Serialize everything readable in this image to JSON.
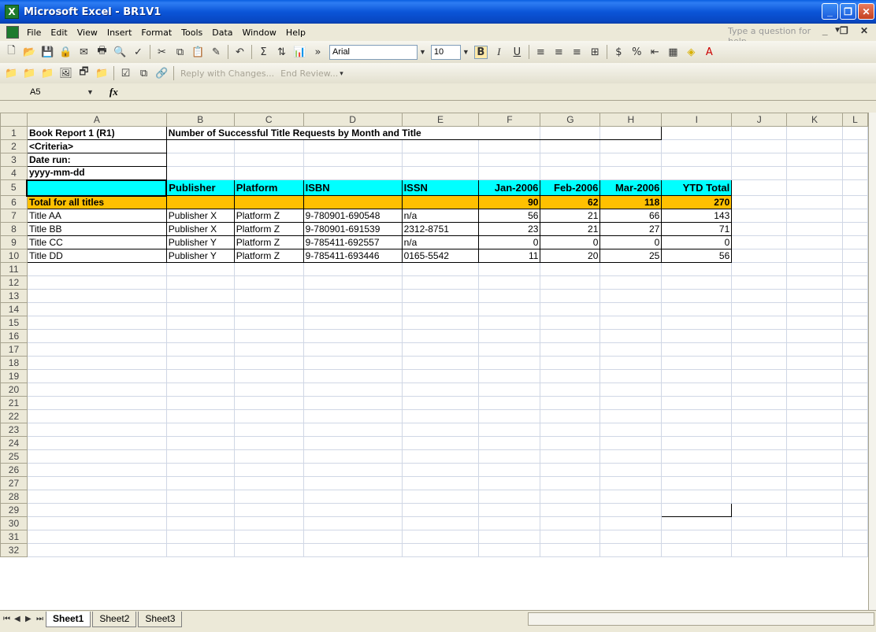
{
  "window": {
    "title": "Microsoft Excel - BR1V1",
    "app_icon": "excel-icon"
  },
  "menu": {
    "items": [
      "File",
      "Edit",
      "View",
      "Insert",
      "Format",
      "Tools",
      "Data",
      "Window",
      "Help"
    ],
    "ask_placeholder": "Type a question for help"
  },
  "toolbar": {
    "font": "Arial",
    "size": "10",
    "reply_label": "Reply with Changes...",
    "end_review_label": "End Review..."
  },
  "formula_bar": {
    "name_box": "A5",
    "fx": "fx"
  },
  "columns": [
    "A",
    "B",
    "C",
    "D",
    "E",
    "F",
    "G",
    "H",
    "I",
    "J",
    "K",
    "L"
  ],
  "sheet": {
    "r1": {
      "a": "Book Report 1 (R1)",
      "b": "Number of Successful Title Requests by Month and Title"
    },
    "r2": {
      "a": "<Criteria>"
    },
    "r3": {
      "a": "Date run:"
    },
    "r4": {
      "a": "yyyy-mm-dd"
    },
    "header": {
      "publisher": "Publisher",
      "platform": "Platform",
      "isbn": "ISBN",
      "issn": "ISSN",
      "jan": "Jan-2006",
      "feb": "Feb-2006",
      "mar": "Mar-2006",
      "ytd": "YTD Total"
    },
    "total": {
      "label": "Total for all titles",
      "jan": "90",
      "feb": "62",
      "mar": "118",
      "ytd": "270"
    },
    "rows": [
      {
        "title": "Title AA",
        "publisher": "Publisher X",
        "platform": "Platform Z",
        "isbn": "9-780901-690548",
        "issn": "n/a",
        "jan": "56",
        "feb": "21",
        "mar": "66",
        "ytd": "143"
      },
      {
        "title": "Title BB",
        "publisher": "Publisher X",
        "platform": "Platform Z",
        "isbn": "9-780901-691539",
        "issn": "2312-8751",
        "jan": "23",
        "feb": "21",
        "mar": "27",
        "ytd": "71"
      },
      {
        "title": "Title CC",
        "publisher": "Publisher Y",
        "platform": "Platform Z",
        "isbn": "9-785411-692557",
        "issn": "n/a",
        "jan": "0",
        "feb": "0",
        "mar": "0",
        "ytd": "0"
      },
      {
        "title": "Title DD",
        "publisher": "Publisher Y",
        "platform": "Platform Z",
        "isbn": "9-785411-693446",
        "issn": "0165-5542",
        "jan": "11",
        "feb": "20",
        "mar": "25",
        "ytd": "56"
      }
    ]
  },
  "tabs": [
    "Sheet1",
    "Sheet2",
    "Sheet3"
  ]
}
